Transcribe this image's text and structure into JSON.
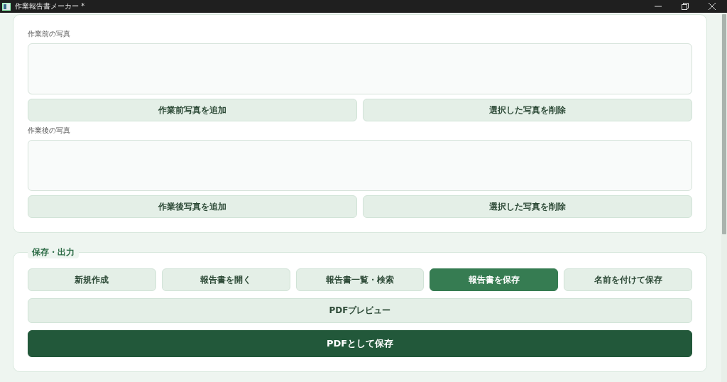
{
  "window": {
    "title": "作業報告書メーカー *"
  },
  "photos_card": {
    "sections": [
      {
        "label": "作業前の写真",
        "buttons": [
          {
            "label": "作業前写真を追加",
            "kind": "normal"
          },
          {
            "label": "選択した写真を削除",
            "kind": "normal"
          }
        ]
      },
      {
        "label": "作業後の写真",
        "buttons": [
          {
            "label": "作業後写真を追加",
            "kind": "normal"
          },
          {
            "label": "選択した写真を削除",
            "kind": "normal"
          }
        ]
      }
    ]
  },
  "output_card": {
    "legend": "保存・出力",
    "rows": [
      [
        {
          "label": "新規作成",
          "kind": "normal"
        },
        {
          "label": "報告書を開く",
          "kind": "normal"
        },
        {
          "label": "報告書一覧・検索",
          "kind": "normal"
        },
        {
          "label": "報告書を保存",
          "kind": "primary"
        },
        {
          "label": "名前を付けて保存",
          "kind": "normal"
        }
      ],
      [
        {
          "label": "PDFプレビュー",
          "kind": "normal"
        }
      ],
      [
        {
          "label": "PDFとして保存",
          "kind": "dark"
        }
      ]
    ]
  }
}
